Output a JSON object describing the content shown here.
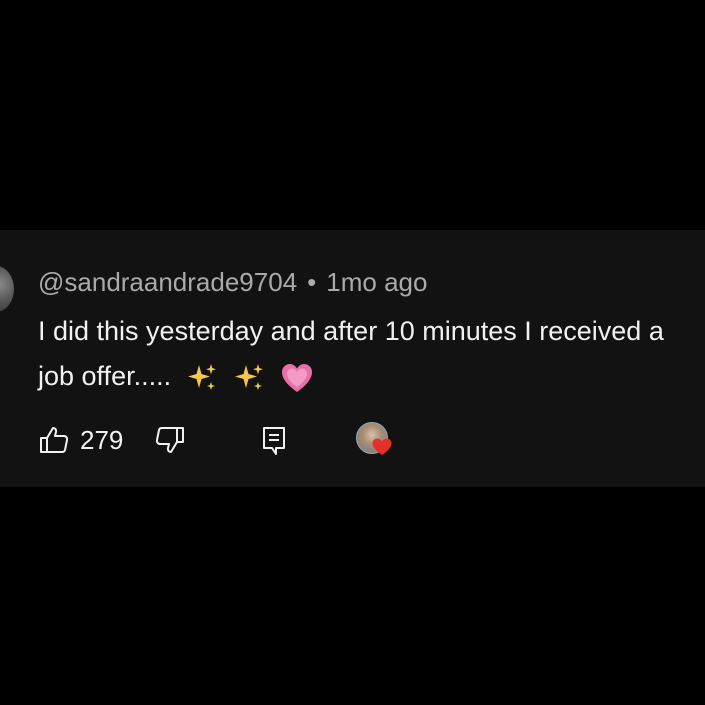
{
  "comment": {
    "author": "@sandraandrade9704",
    "separator": "•",
    "timestamp": "1mo ago",
    "text": "I did this yesterday and after 10 minutes I received a job offer.....",
    "emojis": [
      "sparkles",
      "sparkles",
      "growing-heart"
    ],
    "like_count": "279",
    "creator_hearted": true
  },
  "colors": {
    "background": "#000000",
    "card": "#121212",
    "meta_text": "#aaaaaa",
    "body_text": "#f1f1f1",
    "heart": "#e5302a",
    "pink_heart": "#e86fa8",
    "sparkle": "#f5c84a"
  },
  "icons": {
    "like": "thumbs-up-icon",
    "dislike": "thumbs-down-icon",
    "reply": "comment-icon",
    "creator_heart": "heart-icon"
  }
}
